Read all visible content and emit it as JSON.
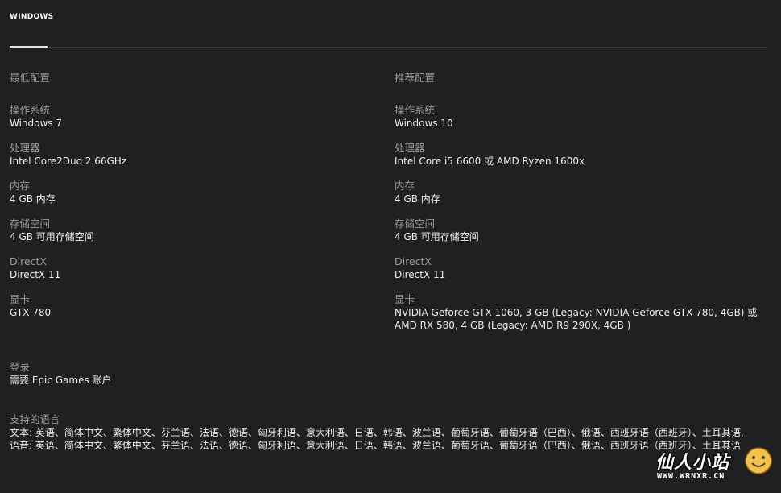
{
  "tabs": [
    {
      "label": "WINDOWS"
    }
  ],
  "minimum": {
    "heading": "最低配置",
    "specs": [
      {
        "label": "操作系统",
        "value": "Windows 7"
      },
      {
        "label": "处理器",
        "value": "Intel Core2Duo 2.66GHz"
      },
      {
        "label": "内存",
        "value": "4 GB 内存"
      },
      {
        "label": "存储空间",
        "value": "4 GB 可用存储空间"
      },
      {
        "label": "DirectX",
        "value": "DirectX 11"
      },
      {
        "label": "显卡",
        "value": "GTX 780"
      }
    ]
  },
  "recommended": {
    "heading": "推荐配置",
    "specs": [
      {
        "label": "操作系统",
        "value": "Windows 10"
      },
      {
        "label": "处理器",
        "value": "Intel Core i5 6600 或 AMD Ryzen 1600x"
      },
      {
        "label": "内存",
        "value": "4 GB 内存"
      },
      {
        "label": "存储空间",
        "value": "4 GB 可用存储空间"
      },
      {
        "label": "DirectX",
        "value": "DirectX 11"
      },
      {
        "label": "显卡",
        "value": "NVIDIA Geforce GTX 1060, 3 GB (Legacy: NVIDIA Geforce GTX 780, 4GB) 或 AMD RX 580, 4 GB (Legacy: AMD R9 290X, 4GB )"
      }
    ]
  },
  "login": {
    "label": "登录",
    "value": "需要 Epic Games 账户"
  },
  "languages": {
    "label": "支持的语言",
    "text": "文本: 英语、简体中文、繁体中文、芬兰语、法语、德语、匈牙利语、意大利语、日语、韩语、波兰语、葡萄牙语、葡萄牙语（巴西）、俄语、西班牙语（西班牙）、土耳其语,",
    "audio": "语音: 英语、简体中文、繁体中文、芬兰语、法语、德语、匈牙利语、意大利语、日语、韩语、波兰语、葡萄牙语、葡萄牙语（巴西）、俄语、西班牙语（西班牙）、土耳其语"
  },
  "watermark": {
    "title": "仙人小站",
    "url": "WWW.WRNXR.CN"
  }
}
